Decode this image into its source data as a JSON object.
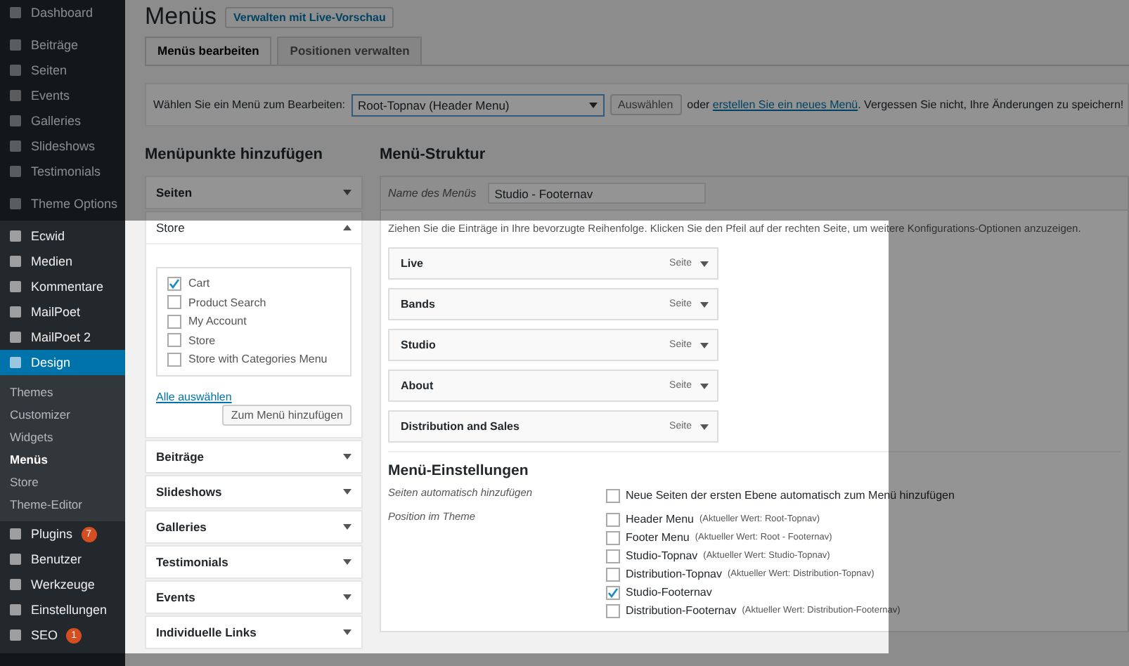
{
  "sidebar": {
    "groups": [
      [
        {
          "label": "Dashboard",
          "selected": false
        }
      ],
      [
        {
          "label": "Beiträge",
          "selected": false
        },
        {
          "label": "Seiten",
          "selected": false
        },
        {
          "label": "Events",
          "selected": false
        },
        {
          "label": "Galleries",
          "selected": false
        },
        {
          "label": "Slideshows",
          "selected": false
        },
        {
          "label": "Testimonials",
          "selected": false
        }
      ],
      [
        {
          "label": "Theme Options",
          "selected": false
        }
      ],
      [
        {
          "label": "Ecwid",
          "selected": false
        },
        {
          "label": "Medien",
          "selected": false
        },
        {
          "label": "Kommentare",
          "selected": false
        },
        {
          "label": "MailPoet",
          "selected": false
        },
        {
          "label": "MailPoet 2",
          "selected": false
        },
        {
          "label": "Design",
          "selected": true,
          "children": [
            {
              "label": "Themes",
              "selected": false
            },
            {
              "label": "Customizer",
              "selected": false
            },
            {
              "label": "Widgets",
              "selected": false
            },
            {
              "label": "Menüs",
              "selected": true
            },
            {
              "label": "Store",
              "selected": false
            },
            {
              "label": "Theme-Editor",
              "selected": false
            }
          ]
        },
        {
          "label": "Plugins",
          "selected": false,
          "badge": "7"
        },
        {
          "label": "Benutzer",
          "selected": false
        },
        {
          "label": "Werkzeuge",
          "selected": false
        },
        {
          "label": "Einstellungen",
          "selected": false
        },
        {
          "label": "SEO",
          "selected": false,
          "badge": "1"
        }
      ]
    ]
  },
  "header": {
    "title": "Menüs",
    "live_button": "Verwalten mit Live-Vorschau"
  },
  "tabs": [
    {
      "label": "Menüs bearbeiten",
      "selected": true
    },
    {
      "label": "Positionen verwalten",
      "selected": false
    }
  ],
  "menu_select": {
    "label": "Wählen Sie ein Menü zum Bearbeiten:",
    "value": "Root-Topnav (Header Menu)",
    "button": "Auswählen",
    "text_before": "oder",
    "link": "erstellen Sie ein neues Menü",
    "text_after": ". Vergessen Sie nicht, Ihre Änderungen zu speichern!"
  },
  "add_items": {
    "heading": "Menüpunkte hinzufügen",
    "panels": [
      {
        "title": "Seiten",
        "expanded": false
      },
      {
        "title": "Store",
        "expanded": true,
        "items": [
          {
            "label": "Cart",
            "checked": true
          },
          {
            "label": "Product Search",
            "checked": false
          },
          {
            "label": "My Account",
            "checked": false
          },
          {
            "label": "Store",
            "checked": false
          },
          {
            "label": "Store with Categories Menu",
            "checked": false
          }
        ],
        "select_all": "Alle auswählen",
        "add_button": "Zum Menü hinzufügen"
      },
      {
        "title": "Beiträge",
        "expanded": false
      },
      {
        "title": "Slideshows",
        "expanded": false
      },
      {
        "title": "Galleries",
        "expanded": false
      },
      {
        "title": "Testimonials",
        "expanded": false
      },
      {
        "title": "Events",
        "expanded": false
      },
      {
        "title": "Individuelle Links",
        "expanded": false
      }
    ]
  },
  "structure": {
    "heading": "Menü-Struktur",
    "name_label": "Name des Menüs",
    "name_value": "Studio - Footernav",
    "instructions": "Ziehen Sie die Einträge in Ihre bevorzugte Reihenfolge. Klicken Sie den Pfeil auf der rechten Seite, um weitere Konfigurations-Optionen anzuzeigen.",
    "items": [
      {
        "title": "Live",
        "type": "Seite"
      },
      {
        "title": "Bands",
        "type": "Seite"
      },
      {
        "title": "Studio",
        "type": "Seite"
      },
      {
        "title": "About",
        "type": "Seite"
      },
      {
        "title": "Distribution and Sales",
        "type": "Seite"
      }
    ],
    "settings_heading": "Menü-Einstellungen",
    "auto_add": {
      "label": "Seiten automatisch hinzufügen",
      "option": "Neue Seiten der ersten Ebene automatisch zum Menü hinzufügen",
      "checked": false
    },
    "positions": {
      "label": "Position im Theme",
      "options": [
        {
          "name": "Header Menu",
          "current": "(Aktueller Wert: Root-Topnav)",
          "checked": false
        },
        {
          "name": "Footer Menu",
          "current": "(Aktueller Wert: Root - Footernav)",
          "checked": false
        },
        {
          "name": "Studio-Topnav",
          "current": "(Aktueller Wert: Studio-Topnav)",
          "checked": false
        },
        {
          "name": "Distribution-Topnav",
          "current": "(Aktueller Wert: Distribution-Topnav)",
          "checked": false
        },
        {
          "name": "Studio-Footernav",
          "checked": true
        },
        {
          "name": "Distribution-Footernav",
          "current": "(Aktueller Wert: Distribution-Footernav)",
          "checked": false
        }
      ]
    }
  }
}
